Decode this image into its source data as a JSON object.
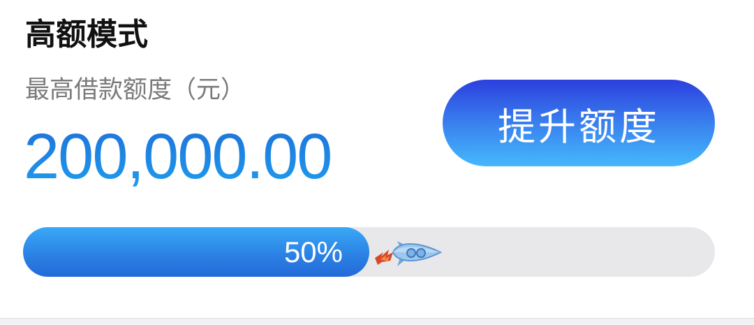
{
  "header": {
    "mode_title": "高额模式"
  },
  "limit": {
    "label": "最高借款额度（元）",
    "amount": "200,000.00"
  },
  "actions": {
    "raise_limit_label": "提升额度"
  },
  "progress": {
    "value": 0.5,
    "label": "50%"
  },
  "icons": {
    "progress_marker": "rocket-icon"
  },
  "colors": {
    "accent": "#1e86e8",
    "button_top": "#2c3fde",
    "button_bottom": "#45b8fc",
    "track": "#e8e8ea",
    "flame": "#d9482b"
  }
}
